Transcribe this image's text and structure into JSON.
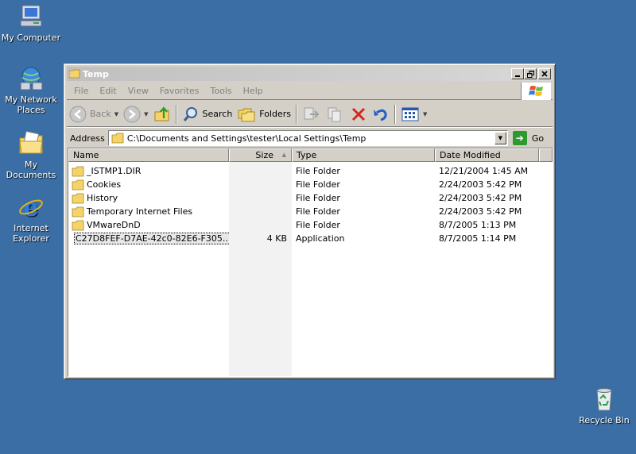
{
  "desktop": {
    "icons": [
      {
        "label": "My Computer"
      },
      {
        "label": "My Network Places"
      },
      {
        "label": "My Documents"
      },
      {
        "label": "Internet Explorer"
      },
      {
        "label": "Recycle Bin"
      }
    ]
  },
  "window": {
    "title": "Temp",
    "menu": [
      "File",
      "Edit",
      "View",
      "Favorites",
      "Tools",
      "Help"
    ],
    "toolbar": {
      "back_label": "Back",
      "search_label": "Search",
      "folders_label": "Folders"
    },
    "address": {
      "label": "Address",
      "value": "C:\\Documents and Settings\\tester\\Local Settings\\Temp",
      "go_label": "Go"
    },
    "columns": {
      "name": "Name",
      "size": "Size",
      "type": "Type",
      "date": "Date Modified"
    },
    "files": [
      {
        "name": "_ISTMP1.DIR",
        "size": "",
        "type": "File Folder",
        "date": "12/21/2004 1:45 AM",
        "icon": "folder-icon"
      },
      {
        "name": "Cookies",
        "size": "",
        "type": "File Folder",
        "date": "2/24/2003 5:42 PM",
        "icon": "folder-icon"
      },
      {
        "name": "History",
        "size": "",
        "type": "File Folder",
        "date": "2/24/2003 5:42 PM",
        "icon": "folder-icon"
      },
      {
        "name": "Temporary Internet Files",
        "size": "",
        "type": "File Folder",
        "date": "2/24/2003 5:42 PM",
        "icon": "folder-icon"
      },
      {
        "name": "VMwareDnD",
        "size": "",
        "type": "File Folder",
        "date": "8/7/2005 1:13 PM",
        "icon": "folder-icon"
      },
      {
        "name": "C27D8FEF-D7AE-42c0-82E6-F305...",
        "size": "4 KB",
        "type": "Application",
        "date": "8/7/2005 1:14 PM",
        "icon": "application-icon"
      }
    ]
  }
}
